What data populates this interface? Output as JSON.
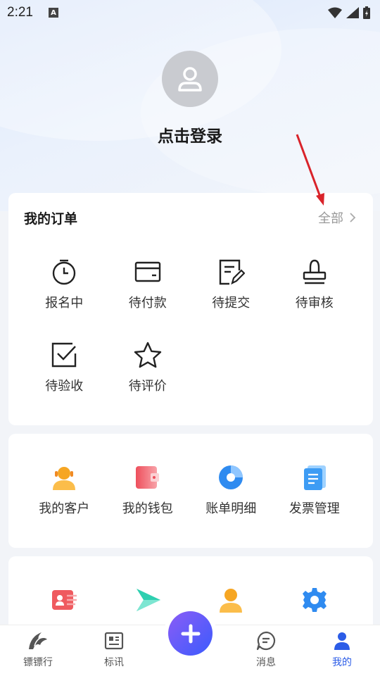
{
  "status": {
    "time": "2:21",
    "notification_icon": "A"
  },
  "profile": {
    "login_label": "点击登录"
  },
  "orders": {
    "title": "我的订单",
    "see_all": "全部",
    "items": [
      {
        "label": "报名中",
        "icon": "timer-icon"
      },
      {
        "label": "待付款",
        "icon": "card-icon"
      },
      {
        "label": "待提交",
        "icon": "edit-doc-icon"
      },
      {
        "label": "待审核",
        "icon": "stamp-icon"
      },
      {
        "label": "待验收",
        "icon": "checkbox-icon"
      },
      {
        "label": "待评价",
        "icon": "star-icon"
      }
    ]
  },
  "tools": {
    "items": [
      {
        "label": "我的客户",
        "icon": "customer-icon"
      },
      {
        "label": "我的钱包",
        "icon": "wallet-icon"
      },
      {
        "label": "账单明细",
        "icon": "pie-chart-icon"
      },
      {
        "label": "发票管理",
        "icon": "invoice-icon"
      }
    ]
  },
  "more": {
    "items": [
      {
        "icon": "id-card-icon"
      },
      {
        "icon": "share-icon"
      },
      {
        "icon": "service-icon"
      },
      {
        "icon": "settings-icon"
      }
    ]
  },
  "tabbar": {
    "tabs": [
      {
        "label": "镖镖行",
        "icon": "logo-icon"
      },
      {
        "label": "标讯",
        "icon": "news-icon"
      },
      {
        "label": "",
        "icon": "plus-icon"
      },
      {
        "label": "消息",
        "icon": "message-icon"
      },
      {
        "label": "我的",
        "icon": "profile-icon"
      }
    ]
  },
  "colors": {
    "accent": "#2b5ce7",
    "plus_start": "#8b5cf6",
    "plus_end": "#3b5bfd"
  }
}
